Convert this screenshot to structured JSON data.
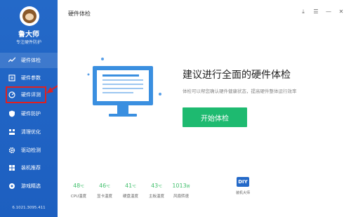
{
  "sidebar": {
    "brand": "鲁大师",
    "slogan": "专注硬件防护",
    "items": [
      {
        "label": "硬件体检",
        "icon": "chart-icon"
      },
      {
        "label": "硬件参数",
        "icon": "list-icon"
      },
      {
        "label": "硬件评测",
        "icon": "gauge-icon"
      },
      {
        "label": "硬件防护",
        "icon": "shield-icon"
      },
      {
        "label": "清理优化",
        "icon": "broom-icon"
      },
      {
        "label": "驱动检测",
        "icon": "gear-icon"
      },
      {
        "label": "装机推荐",
        "icon": "puzzle-icon"
      },
      {
        "label": "游戏精选",
        "icon": "gamepad-icon"
      }
    ],
    "version": "6.1021.3095.411"
  },
  "main": {
    "title": "硬件体检",
    "headline": "建议进行全面的硬件体检",
    "subtext": "体检可以帮您确认硬件健康状态，提高硬件整体运行效率",
    "start_button": "开始体检"
  },
  "window": {
    "download": "⤓",
    "menu": "☰",
    "minimize": "—",
    "close": "✕"
  },
  "stats": [
    {
      "value": "48",
      "unit": "℃",
      "label": "CPU温度"
    },
    {
      "value": "46",
      "unit": "℃",
      "label": "显卡温度"
    },
    {
      "value": "41",
      "unit": "℃",
      "label": "硬盘温度"
    },
    {
      "value": "43",
      "unit": "℃",
      "label": "主板温度"
    },
    {
      "value": "1013",
      "unit": "转",
      "label": "风扇转速"
    }
  ],
  "diy": {
    "badge": "DIY",
    "label": "装机大师"
  },
  "colors": {
    "sidebar": "#2469c8",
    "accent_green": "#1eba70",
    "stat_green": "#3fbf6b",
    "highlight_red": "#e02020"
  }
}
